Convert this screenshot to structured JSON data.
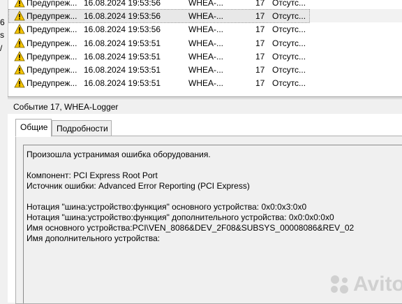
{
  "left_strip": [
    "6",
    "s",
    "/"
  ],
  "events": [
    {
      "level": "Предупреж...",
      "datetime": "16.08.2024 19:53:56",
      "source": "WHEA-...",
      "id": "17",
      "task": "Отсутс...",
      "selected": false
    },
    {
      "level": "Предупреж...",
      "datetime": "16.08.2024 19:53:56",
      "source": "WHEA-...",
      "id": "17",
      "task": "Отсутс...",
      "selected": true
    },
    {
      "level": "Предупреж...",
      "datetime": "16.08.2024 19:53:56",
      "source": "WHEA-...",
      "id": "17",
      "task": "Отсутс...",
      "selected": false
    },
    {
      "level": "Предупреж...",
      "datetime": "16.08.2024 19:53:51",
      "source": "WHEA-...",
      "id": "17",
      "task": "Отсутс...",
      "selected": false
    },
    {
      "level": "Предупреж...",
      "datetime": "16.08.2024 19:53:51",
      "source": "WHEA-...",
      "id": "17",
      "task": "Отсутс...",
      "selected": false
    },
    {
      "level": "Предупреж...",
      "datetime": "16.08.2024 19:53:51",
      "source": "WHEA-...",
      "id": "17",
      "task": "Отсутс...",
      "selected": false
    },
    {
      "level": "Предупреж...",
      "datetime": "16.08.2024 19:53:51",
      "source": "WHEA-...",
      "id": "17",
      "task": "Отсутс...",
      "selected": false
    }
  ],
  "detail_title": "Событие 17, WHEA-Logger",
  "tabs": {
    "general": "Общие",
    "details": "Подробности"
  },
  "description": [
    "Произошла устранимая ошибка оборудования.",
    "",
    "Компонент: PCI Express Root Port",
    "Источник ошибки: Advanced Error Reporting (PCI Express)",
    "",
    "Нотация \"шина:устройство:функция\" основного устройства: 0x0:0x3:0x0",
    "Нотация \"шина:устройство:функция\" дополнительного устройства: 0x0:0x0:0x0",
    "Имя основного устройства:PCI\\VEN_8086&DEV_2F08&SUBSYS_00008086&REV_02",
    "Имя дополнительного устройства:"
  ],
  "watermark": "Avito",
  "icon": "warning-triangle-icon",
  "colors": {
    "warning_yellow": "#f5c400",
    "selection": "#e8e8e8"
  }
}
